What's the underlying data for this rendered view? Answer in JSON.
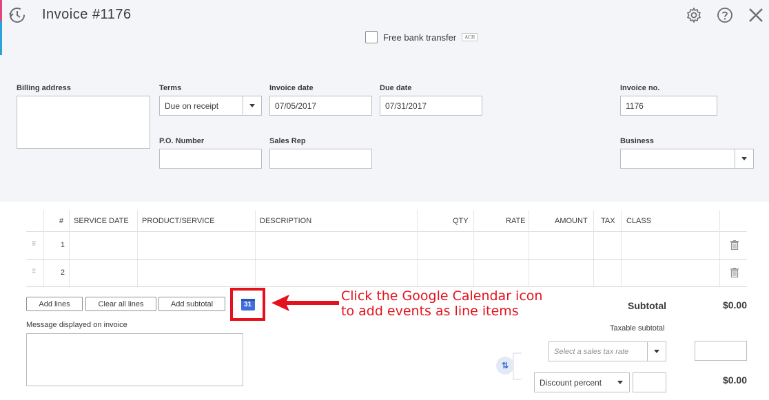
{
  "header": {
    "title": "Invoice",
    "number": "#1176"
  },
  "payment": {
    "free_bank_transfer_label": "Free bank transfer",
    "ach_badge": "ACH"
  },
  "form": {
    "billing_address_label": "Billing address",
    "terms_label": "Terms",
    "terms_value": "Due on receipt",
    "invoice_date_label": "Invoice date",
    "invoice_date_value": "07/05/2017",
    "due_date_label": "Due date",
    "due_date_value": "07/31/2017",
    "invoice_no_label": "Invoice no.",
    "invoice_no_value": "1176",
    "po_number_label": "P.O. Number",
    "sales_rep_label": "Sales Rep",
    "business_label": "Business"
  },
  "table": {
    "columns": [
      "#",
      "SERVICE DATE",
      "PRODUCT/SERVICE",
      "DESCRIPTION",
      "QTY",
      "RATE",
      "AMOUNT",
      "TAX",
      "CLASS"
    ],
    "rows": [
      "1",
      "2"
    ]
  },
  "actions": {
    "add_lines": "Add lines",
    "clear_all_lines": "Clear all lines",
    "add_subtotal": "Add subtotal",
    "gcal_day": "31"
  },
  "annotation": {
    "line1": "Click the Google Calendar icon",
    "line2": "to add events as line items"
  },
  "message": {
    "label": "Message displayed on invoice"
  },
  "totals": {
    "subtotal_label": "Subtotal",
    "subtotal_value": "$0.00",
    "taxable_subtotal_label": "Taxable subtotal",
    "sales_tax_placeholder": "Select a sales tax rate",
    "discount_type": "Discount percent",
    "discount_value": "$0.00"
  },
  "colors": {
    "accent_red": "#e4121c",
    "gcal_blue": "#3f6dd9",
    "header_bg": "#f4f5f8"
  }
}
